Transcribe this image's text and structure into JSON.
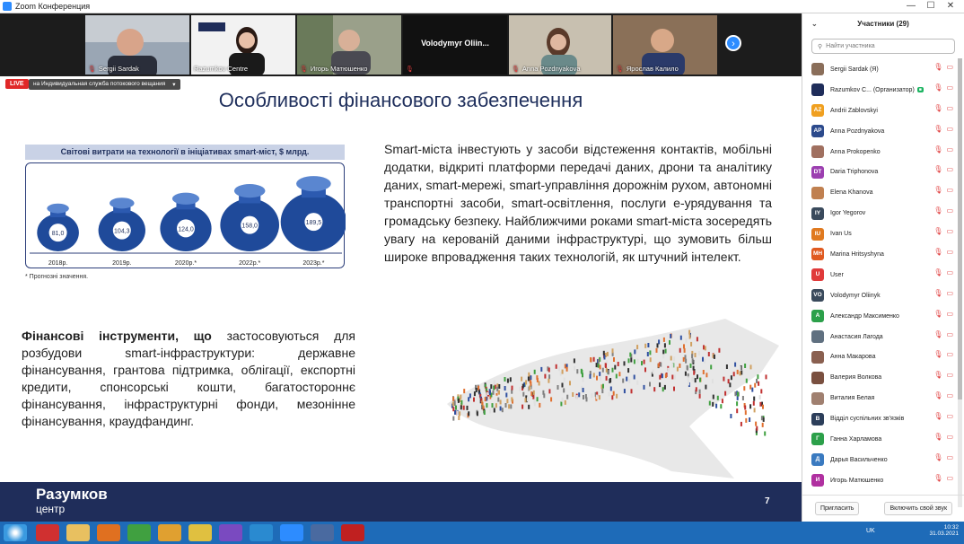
{
  "window": {
    "title": "Zoom Конференция"
  },
  "video": {
    "tiles": [
      {
        "name": "Sergii Sardak"
      },
      {
        "name": "Razumkov Centre"
      },
      {
        "name": "Игорь Матюшенко"
      },
      {
        "name": "Volodymyr Oliin..."
      },
      {
        "name": "Anna Pozdnyakova"
      },
      {
        "name": "Ярослав Калило"
      }
    ]
  },
  "live": {
    "badge": "LIVE",
    "service": "на Индивидуальная служба потокового вещания"
  },
  "slide": {
    "title": "Особливості фінансового забезпечення",
    "chart_data": {
      "type": "bar",
      "title": "Світові витрати на технології в ініціативах smart-міст, $ млрд.",
      "categories": [
        "2018р.",
        "2019р.",
        "2020р.*",
        "2022р.*",
        "2023р.*"
      ],
      "values": [
        81.0,
        104.3,
        124.0,
        158.0,
        189.5
      ],
      "value_labels": [
        "81,0",
        "104,3",
        "124,0",
        "158,0",
        "189,5"
      ],
      "note": "* Прогнозні значення.",
      "ylim": [
        0,
        200
      ]
    },
    "right_text": "Smart-міста інвестують у засоби відстеження контактів, мобільні додатки, відкриті платформи передачі даних, дрони та аналітику даних, smart-мережі, smart-управління дорожнім рухом, автономні транспортні засоби, smart-освітлення, послуги е-урядування та громадську безпеку. Найближчими роками smart-міста зосередять увагу на керованій даними інфраструктурі, що зумовить більш широке впровадження таких технологій, як штучний інтелект.",
    "left_text_bold": "Фінансові інструменти, що",
    "left_text": " застосовуються для розбудови smart-інфраструктури: державне фінансування, грантова підтримка, облігації, експортні кредити, спонсорські кошти, багатостороннє фінансування, інфраструктурні фонди, мезонінне фінансування, краудфандинг.",
    "footer_brand": "Разумков",
    "footer_sub": "центр",
    "page_number": "7"
  },
  "participants": {
    "title": "Участники (29)",
    "search_placeholder": "Найти участника",
    "list": [
      {
        "initials": "",
        "name": "Sergii Sardak (Я)",
        "color": "#8a6e5a"
      },
      {
        "initials": "",
        "name": "Razumkov C... (Организатор)",
        "color": "#1f2d5a"
      },
      {
        "initials": "AZ",
        "name": "Andrii Zablovskyi",
        "color": "#f0a020"
      },
      {
        "initials": "AP",
        "name": "Anna Pozdnyakova",
        "color": "#2c4a8c"
      },
      {
        "initials": "",
        "name": "Anna Prokopenko",
        "color": "#a07060"
      },
      {
        "initials": "DT",
        "name": "Daria Triphonova",
        "color": "#9c3fb0"
      },
      {
        "initials": "",
        "name": "Elena Khanova",
        "color": "#c08050"
      },
      {
        "initials": "IY",
        "name": "Igor Yegorov",
        "color": "#3a4a5c"
      },
      {
        "initials": "IU",
        "name": "Ivan Us",
        "color": "#e07a20"
      },
      {
        "initials": "MH",
        "name": "Marina Hritsyshyna",
        "color": "#e05a20"
      },
      {
        "initials": "U",
        "name": "User",
        "color": "#e03a3a"
      },
      {
        "initials": "VO",
        "name": "Volodymyr Oliinyk",
        "color": "#3a4a5c"
      },
      {
        "initials": "А",
        "name": "Александр Максименко",
        "color": "#2ca04a"
      },
      {
        "initials": "",
        "name": "Анастасия Лагода",
        "color": "#607080"
      },
      {
        "initials": "",
        "name": "Анна Макарова",
        "color": "#8a6050"
      },
      {
        "initials": "",
        "name": "Валерия Волкова",
        "color": "#7a5040"
      },
      {
        "initials": "",
        "name": "Виталия Белая",
        "color": "#a08070"
      },
      {
        "initials": "В",
        "name": "Відділ суспільних зв'язків",
        "color": "#2c3e5a"
      },
      {
        "initials": "Г",
        "name": "Ганна Харламова",
        "color": "#2ca04a"
      },
      {
        "initials": "Д",
        "name": "Дарья Васильченко",
        "color": "#3a7ac0"
      },
      {
        "initials": "И",
        "name": "Игорь Матюшенко",
        "color": "#b030a0"
      }
    ],
    "invite_button": "Пригласить",
    "unmute_button": "Включить свой звук"
  },
  "taskbar": {
    "lang": "UK",
    "time": "10:32",
    "date": "31.03.2021"
  }
}
